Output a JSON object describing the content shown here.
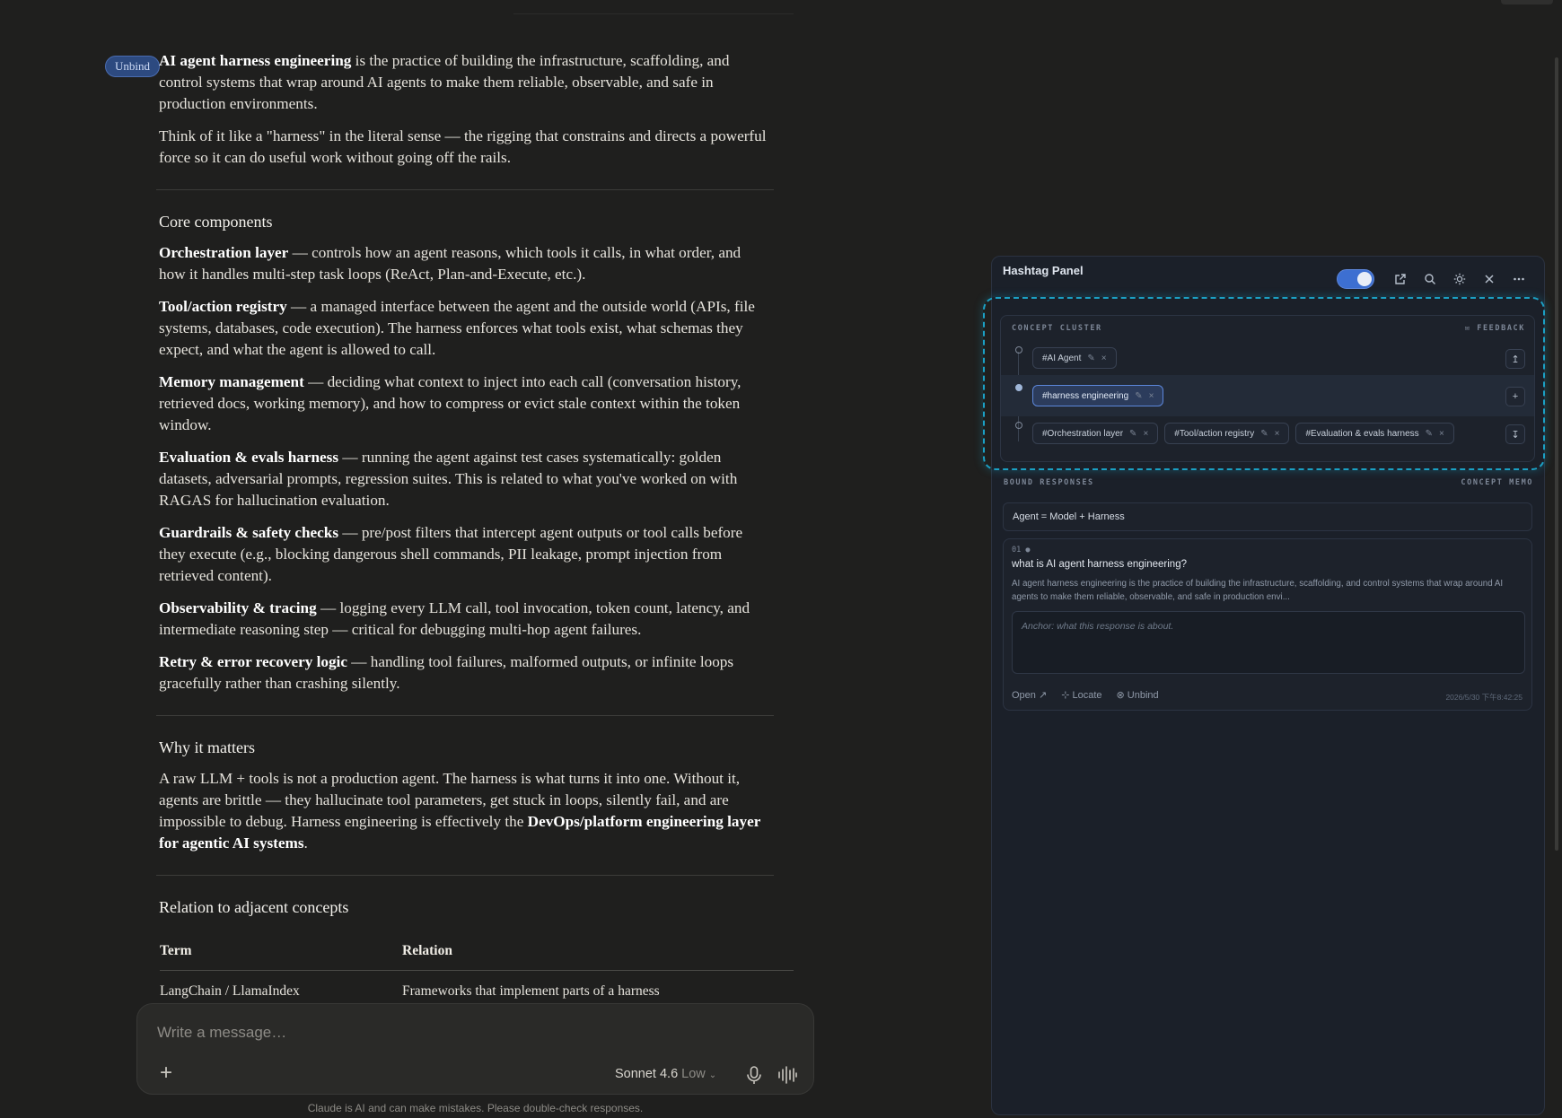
{
  "chat": {
    "unbind_chip": "Unbind",
    "intro_bold": "AI agent harness engineering",
    "intro_rest": " is the practice of building the infrastructure, scaffolding, and control systems that wrap around AI agents to make them reliable, observable, and safe in production environments.",
    "analogy": "Think of it like a \"harness\" in the literal sense — the rigging that constrains and directs a powerful force so it can do useful work without going off the rails.",
    "core_title": "Core components",
    "components": [
      {
        "name": "Orchestration layer",
        "text": " — controls how an agent reasons, which tools it calls, in what order, and how it handles multi-step task loops (ReAct, Plan-and-Execute, etc.)."
      },
      {
        "name": "Tool/action registry",
        "text": " — a managed interface between the agent and the outside world (APIs, file systems, databases, code execution). The harness enforces what tools exist, what schemas they expect, and what the agent is allowed to call."
      },
      {
        "name": "Memory management",
        "text": " — deciding what context to inject into each call (conversation history, retrieved docs, working memory), and how to compress or evict stale context within the token window."
      },
      {
        "name": "Evaluation & evals harness",
        "text": " — running the agent against test cases systematically: golden datasets, adversarial prompts, regression suites. This is related to what you've worked on with RAGAS for hallucination evaluation."
      },
      {
        "name": "Guardrails & safety checks",
        "text": " — pre/post filters that intercept agent outputs or tool calls before they execute (e.g., blocking dangerous shell commands, PII leakage, prompt injection from retrieved content)."
      },
      {
        "name": "Observability & tracing",
        "text": " — logging every LLM call, tool invocation, token count, latency, and intermediate reasoning step — critical for debugging multi-hop agent failures."
      },
      {
        "name": "Retry & error recovery logic",
        "text": " — handling tool failures, malformed outputs, or infinite loops gracefully rather than crashing silently."
      }
    ],
    "why_title": "Why it matters",
    "why_text": "A raw LLM + tools is not a production agent. The harness is what turns it into one. Without it, agents are brittle — they hallucinate tool parameters, get stuck in loops, silently fail, and are impossible to debug. Harness engineering is effectively the ",
    "why_bold": "DevOps/platform engineering layer for agentic AI systems",
    "why_end": ".",
    "relation_title": "Relation to adjacent concepts",
    "table_headers": [
      "Term",
      "Relation"
    ],
    "table_rows": [
      [
        "LangChain / LlamaIndex",
        "Frameworks that implement parts of a harness"
      ]
    ]
  },
  "composer": {
    "placeholder": "Write a message…",
    "model": "Sonnet 4.6",
    "effort": "Low",
    "disclaimer": "Claude is AI and can make mistakes. Please double-check responses."
  },
  "panel": {
    "title": "Hashtag Panel",
    "toggle_on": true,
    "concept_cluster_label": "CONCEPT CLUSTER",
    "feedback_label": "FEEDBACK",
    "rows": [
      {
        "tags": [
          "#AI Agent"
        ],
        "button": "↥",
        "active": false
      },
      {
        "tags": [
          "#harness engineering"
        ],
        "button": "+",
        "active": true
      },
      {
        "tags": [
          "#Orchestration layer",
          "#Tool/action registry",
          "#Evaluation & evals harness"
        ],
        "button": "↧",
        "active": false
      }
    ],
    "bound_responses_label": "BOUND RESPONSES",
    "concept_memo_label": "CONCEPT MEMO",
    "memo_text": "Agent = Model + Harness",
    "response": {
      "index": "01",
      "question": "what is AI agent harness engineering?",
      "answer": "AI agent harness engineering is the practice of building the infrastructure, scaffolding, and control systems that wrap around AI agents to make them reliable, observable, and safe in production envi...",
      "anchor_placeholder": "Anchor: what this response is about.",
      "actions": [
        "Open ↗",
        "⊹ Locate",
        "⊗ Unbind"
      ],
      "timestamp": "2026/5/30 下午8:42:25"
    }
  },
  "colors": {
    "background": "#1f1f1e",
    "panel_bg": "#1b2029",
    "accent_blue": "#3d6fd1",
    "highlight_outline": "#1ba0c4"
  }
}
